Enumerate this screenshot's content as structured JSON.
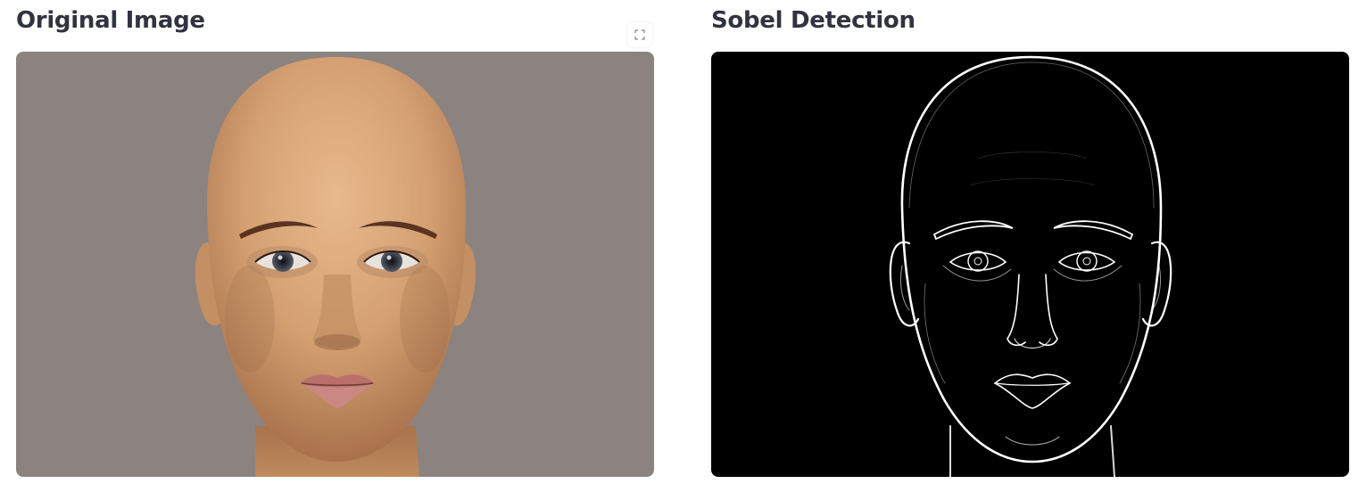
{
  "left_panel": {
    "title": "Original Image",
    "fullscreen_icon": "expand-icon",
    "image_subject": "head",
    "background_color": "#8b8380"
  },
  "right_panel": {
    "title": "Sobel Detection",
    "image_subject": "head",
    "background_color": "#000000"
  },
  "colors": {
    "text": "#31333f",
    "skin": "#d7a77a",
    "edge": "#ffffff"
  }
}
